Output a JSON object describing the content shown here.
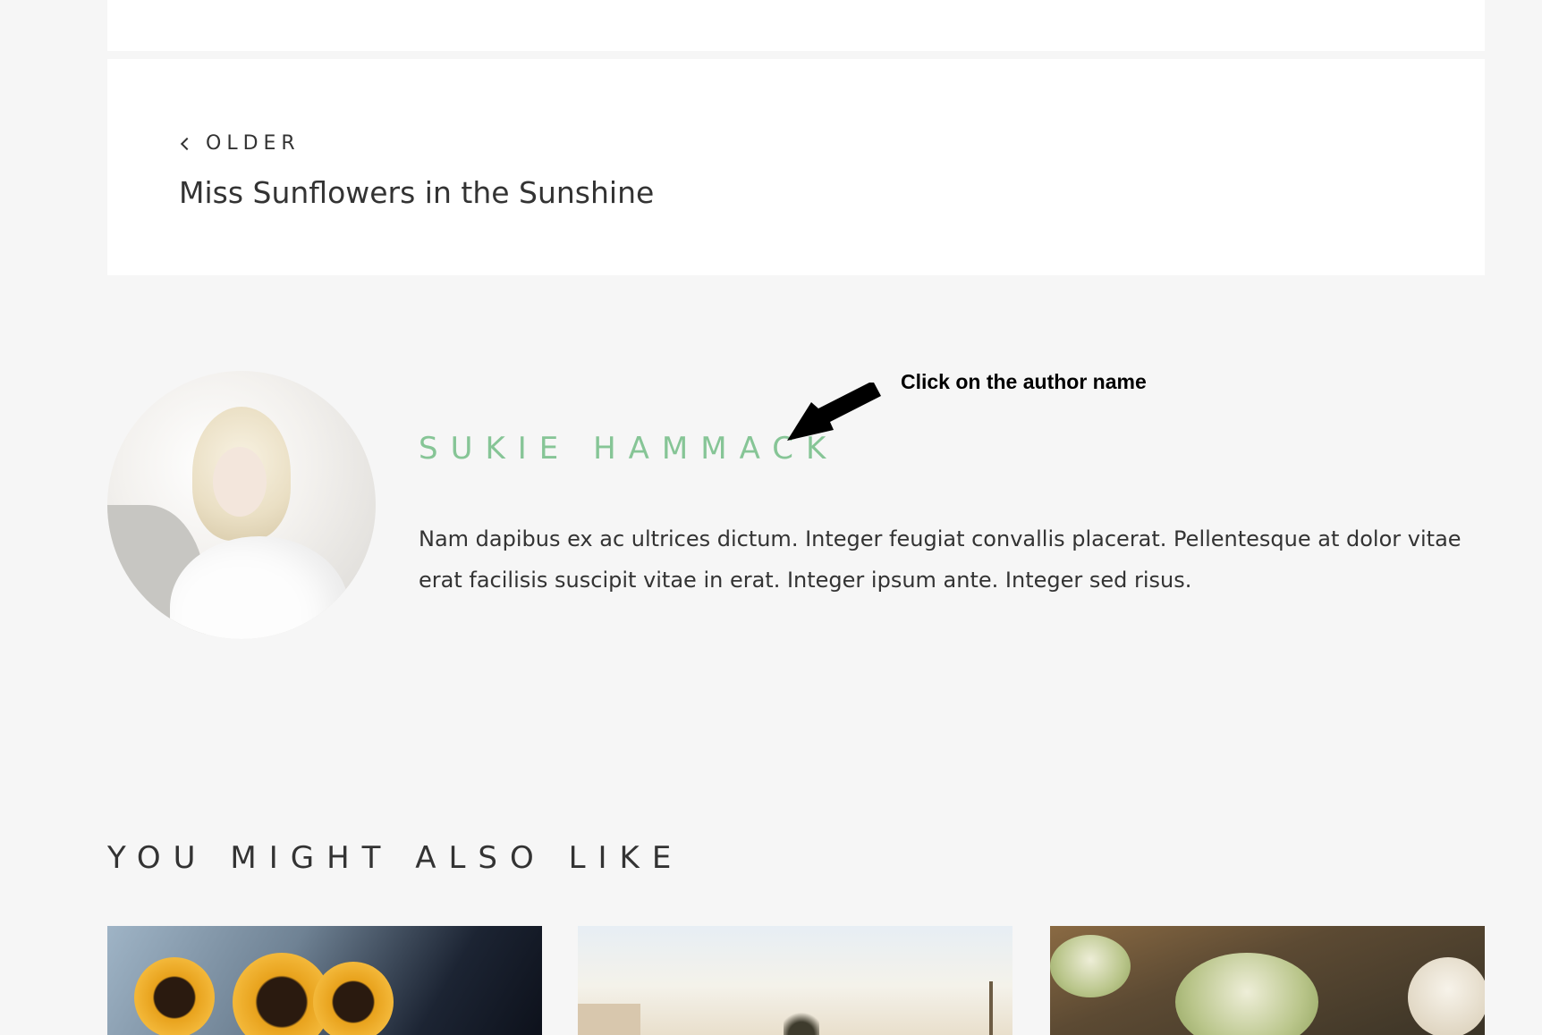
{
  "navigation": {
    "older_label": "OLDER",
    "older_post_title": "Miss Sunflowers in the Sunshine"
  },
  "author": {
    "name": "SUKIE HAMMACK",
    "bio": "Nam dapibus ex ac ultrices dictum. Integer feugiat convallis placerat. Pellentesque at dolor vitae erat facilisis suscipit vitae in erat. Integer ipsum ante. Integer sed risus.",
    "name_color": "#86c596"
  },
  "annotation": {
    "text": "Click on the author name"
  },
  "related": {
    "heading": "YOU MIGHT ALSO LIKE"
  },
  "icons": {
    "older_chevron": "chevron-left-icon",
    "annotation_arrow": "arrow-icon"
  },
  "colors": {
    "page_background": "#f6f6f6",
    "card_background": "#ffffff",
    "text": "#333333",
    "accent": "#86c596"
  }
}
